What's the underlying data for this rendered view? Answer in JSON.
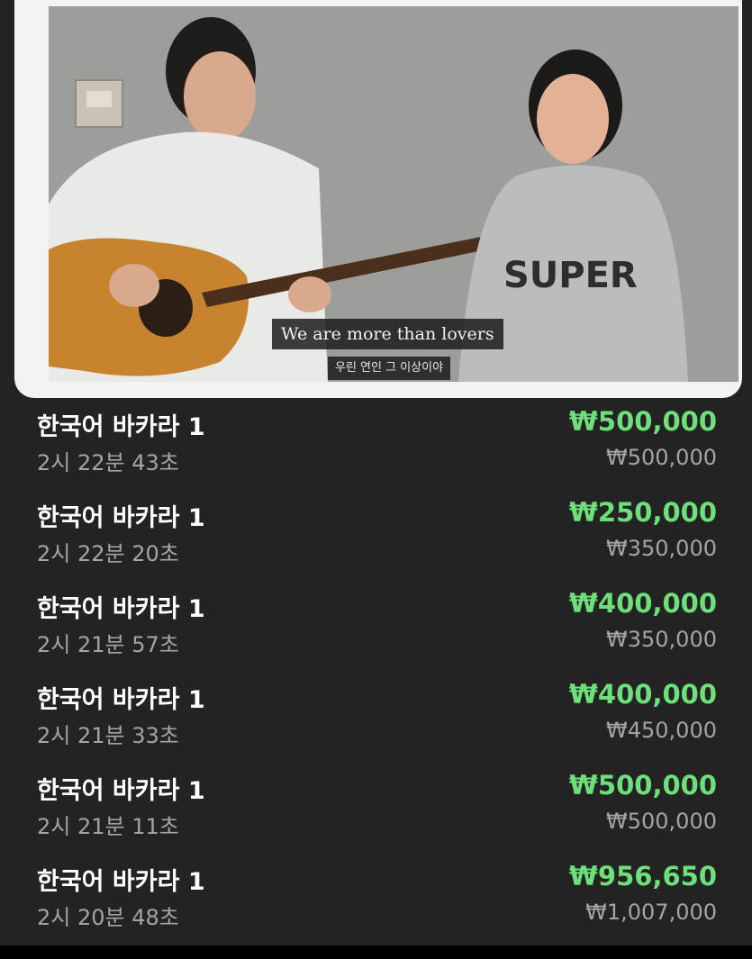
{
  "video": {
    "caption_en": "We are more than lovers",
    "caption_ko": "우린 연인 그 이상이야",
    "shirt_text": "SUPER"
  },
  "colors": {
    "panel_bg": "#232323",
    "amount_green": "#6ee07a",
    "secondary_gray": "#a4a4a4"
  },
  "transactions": [
    {
      "name": "한국어 바카라 1",
      "time": "2시 22분 43초",
      "amount": "₩500,000",
      "balance": "₩500,000"
    },
    {
      "name": "한국어 바카라 1",
      "time": "2시 22분 20초",
      "amount": "₩250,000",
      "balance": "₩350,000"
    },
    {
      "name": "한국어 바카라 1",
      "time": "2시 21분 57초",
      "amount": "₩400,000",
      "balance": "₩350,000"
    },
    {
      "name": "한국어 바카라 1",
      "time": "2시 21분 33초",
      "amount": "₩400,000",
      "balance": "₩450,000"
    },
    {
      "name": "한국어 바카라 1",
      "time": "2시 21분 11초",
      "amount": "₩500,000",
      "balance": "₩500,000"
    },
    {
      "name": "한국어 바카라 1",
      "time": "2시 20분 48초",
      "amount": "₩956,650",
      "balance": "₩1,007,000"
    }
  ]
}
